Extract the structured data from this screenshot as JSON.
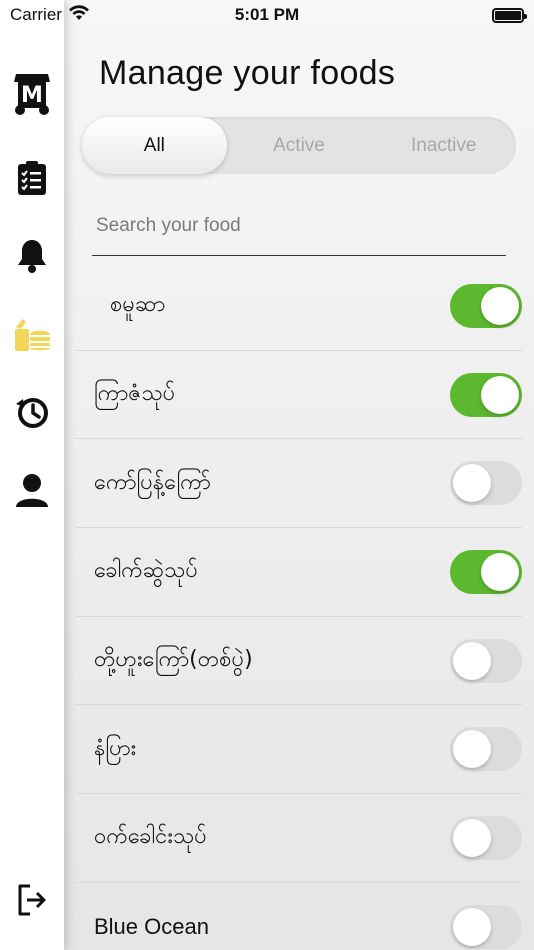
{
  "status_bar": {
    "carrier": "Carrier",
    "time": "5:01 PM"
  },
  "sidebar": {
    "items": [
      {
        "name": "logo-icon",
        "active": false
      },
      {
        "name": "clipboard-icon",
        "active": false
      },
      {
        "name": "bell-icon",
        "active": false
      },
      {
        "name": "food-icon",
        "active": true
      },
      {
        "name": "history-icon",
        "active": false
      },
      {
        "name": "profile-icon",
        "active": false
      },
      {
        "name": "logout-icon",
        "active": false
      }
    ],
    "logo_letter": "M",
    "active_color": "#f2d65a"
  },
  "main": {
    "title": "Manage your foods",
    "tabs": [
      {
        "label": "All",
        "active": true
      },
      {
        "label": "Active",
        "active": false
      },
      {
        "label": "Inactive",
        "active": false
      }
    ],
    "search": {
      "placeholder": "Search your food",
      "value": ""
    }
  },
  "foods": [
    {
      "name": "စမူဆာ",
      "enabled": true
    },
    {
      "name": "ကြာဇံသုပ်",
      "enabled": true
    },
    {
      "name": "ကော်ပြန့်ကြော်",
      "enabled": false
    },
    {
      "name": "ခေါက်ဆွဲသုပ်",
      "enabled": true
    },
    {
      "name": "တို့ဟူးကြော်(တစ်ပွဲ)",
      "enabled": false
    },
    {
      "name": "နံပြား",
      "enabled": false
    },
    {
      "name": "ဝက်ခေါင်းသုပ်",
      "enabled": false
    },
    {
      "name": "Blue Ocean",
      "enabled": false
    }
  ],
  "colors": {
    "toggle_on": "#5cb82e",
    "toggle_off": "#dcdcdc"
  }
}
